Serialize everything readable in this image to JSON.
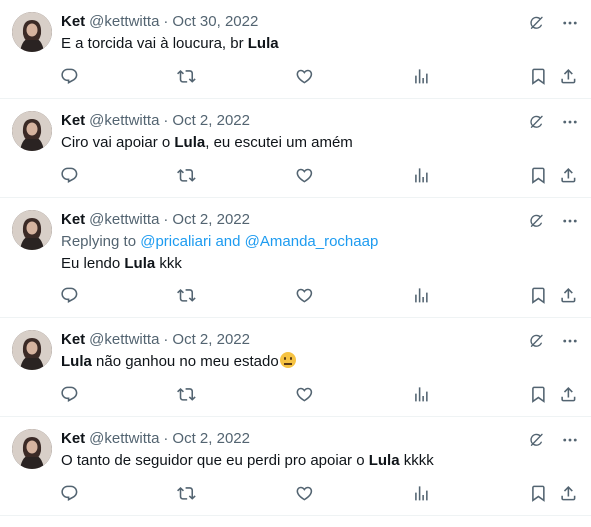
{
  "icons": {
    "reply": "reply-icon",
    "retweet": "retweet-icon",
    "like": "like-icon",
    "views": "views-icon",
    "bookmark": "bookmark-icon",
    "share": "share-icon",
    "grok": "grok-icon",
    "more": "more-icon"
  },
  "colors": {
    "text": "#0f1419",
    "muted": "#536471",
    "link": "#1d9bf0",
    "divider": "#eff3f4"
  },
  "tweets": [
    {
      "name": "Ket",
      "handle": "@kettwitta",
      "dot": "·",
      "date": "Oct 30, 2022",
      "text_before": "E a torcida vai à loucura, br ",
      "highlight": "Lula",
      "text_after": ""
    },
    {
      "name": "Ket",
      "handle": "@kettwitta",
      "dot": "·",
      "date": "Oct 2, 2022",
      "text_before": "Ciro vai apoiar o ",
      "highlight": "Lula",
      "text_after": ", eu escutei um amém"
    },
    {
      "name": "Ket",
      "handle": "@kettwitta",
      "dot": "·",
      "date": "Oct 2, 2022",
      "reply_prefix": "Replying to ",
      "reply_to": "@pricaliari and @Amanda_rochaap",
      "text_before": "Eu lendo ",
      "highlight": "Lula",
      "text_after": " kkk"
    },
    {
      "name": "Ket",
      "handle": "@kettwitta",
      "dot": "·",
      "date": "Oct 2, 2022",
      "text_before": "",
      "highlight": "Lula",
      "text_after": " não ganhou no meu estado",
      "emoji": "confused-face-emoji"
    },
    {
      "name": "Ket",
      "handle": "@kettwitta",
      "dot": "·",
      "date": "Oct 2, 2022",
      "text_before": "O tanto de seguidor que eu perdi pro apoiar o ",
      "highlight": "Lula",
      "text_after": " kkkk"
    }
  ]
}
